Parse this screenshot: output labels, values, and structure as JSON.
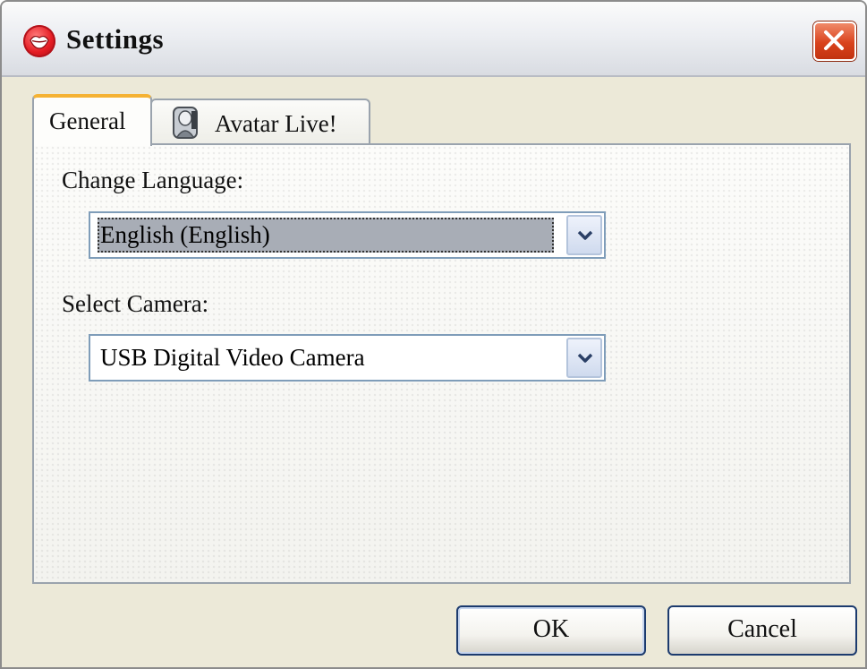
{
  "window": {
    "title": "Settings"
  },
  "tabs": [
    {
      "label": "General",
      "active": true
    },
    {
      "label": "Avatar Live!",
      "active": false
    }
  ],
  "general": {
    "language_label": "Change Language:",
    "language_value": "English (English)",
    "camera_label": "Select Camera:",
    "camera_value": "USB Digital Video Camera"
  },
  "buttons": {
    "ok": "OK",
    "cancel": "Cancel"
  },
  "icons": {
    "app": "lips-icon",
    "close": "close-icon",
    "avatar_tab": "avatar-icon",
    "dropdown": "chevron-down-icon"
  },
  "colors": {
    "window_bg": "#ece9d8",
    "active_tab_accent": "#f5b233",
    "close_button": "#d9421c",
    "input_border": "#7f9db9",
    "selected_text_bg": "#a8adb6"
  }
}
